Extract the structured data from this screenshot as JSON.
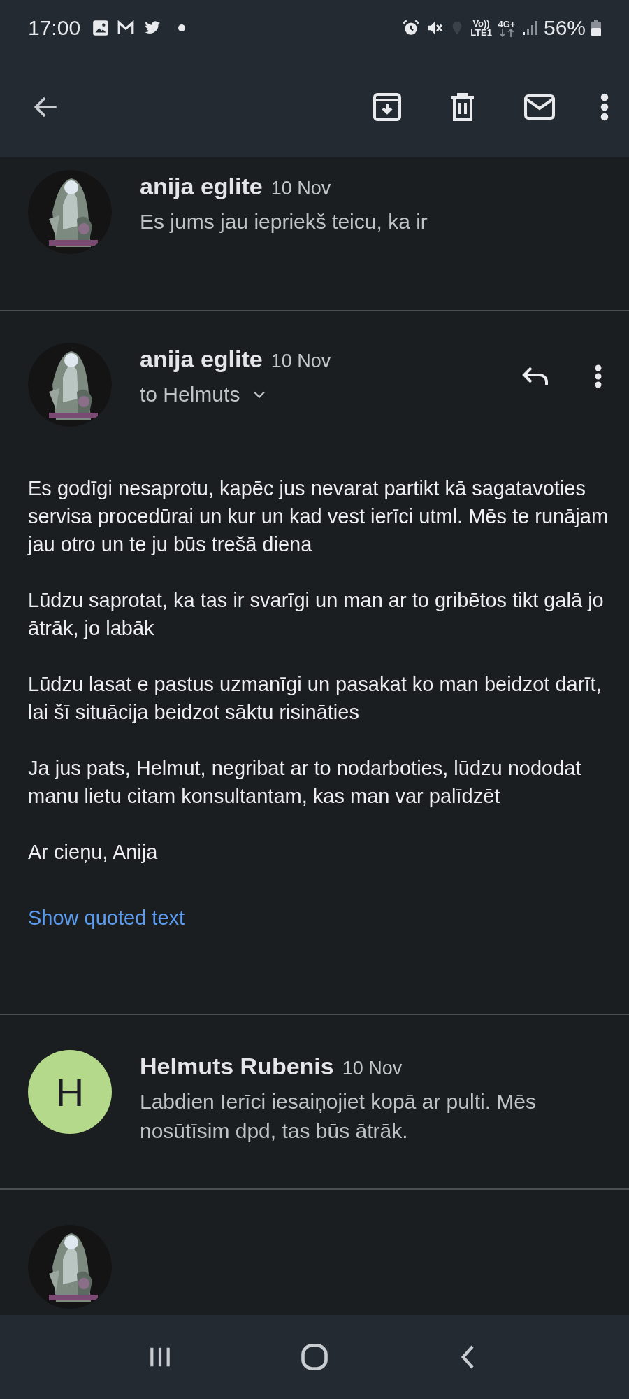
{
  "status_bar": {
    "time": "17:00",
    "volte_top": "Vo))",
    "volte_bottom": "LTE1",
    "network": "4G+",
    "battery": "56%"
  },
  "messages": [
    {
      "kind": "collapsed",
      "sender": "anija eglite",
      "date": "10 Nov",
      "snippet": "Es jums jau iepriekš teicu, ka ir"
    },
    {
      "kind": "expanded",
      "sender": "anija eglite",
      "date": "10 Nov",
      "recipient": "to Helmuts",
      "paragraphs": [
        "Es godīgi nesaprotu, kapēc jus nevarat partikt kā sagatavoties servisa procedūrai un kur un kad vest ierīci utml. Mēs te runājam jau otro un te ju būs trešā diena",
        "Lūdzu saprotat, ka tas ir svarīgi un man ar to gribētos tikt galā jo ātrāk, jo labāk",
        "Lūdzu lasat e pastus uzmanīgi un pasakat ko man beidzot darīt, lai šī situācija beidzot sāktu risināties",
        "Ja jus pats, Helmut, negribat ar to nodarboties, lūdzu nododat manu lietu citam konsultantam, kas man var palīdzēt",
        "Ar cieņu, Anija"
      ],
      "quoted_link": "Show quoted text"
    },
    {
      "kind": "collapsed",
      "sender": "Helmuts Rubenis",
      "date": "10 Nov",
      "snippet": "Labdien Ierīci iesaiņojiet kopā ar pulti. Mēs nosūtīsim dpd, tas būs ātrāk.",
      "avatar": {
        "kind": "letter",
        "letter": "H",
        "color": "#b5d98a"
      }
    },
    {
      "kind": "partial"
    }
  ]
}
